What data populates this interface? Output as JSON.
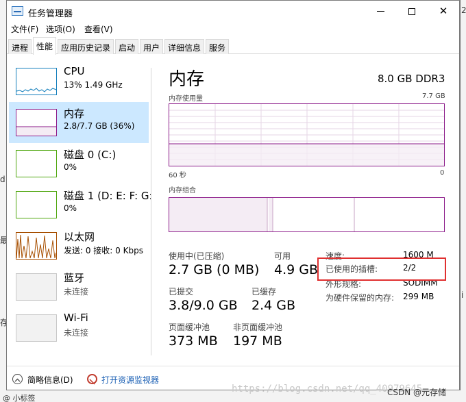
{
  "window": {
    "title": "任务管理器"
  },
  "background_text": {
    "right_top": "2",
    "left_mid": "d",
    "left_low": "最",
    "left_bottom": "存",
    "right_mid": "ⅰ",
    "bottom_strip": "@ 小标签"
  },
  "menu": [
    "文件(F)",
    "选项(O)",
    "查看(V)"
  ],
  "tabs": [
    {
      "label": "进程",
      "active": false
    },
    {
      "label": "性能",
      "active": true
    },
    {
      "label": "应用历史记录",
      "active": false
    },
    {
      "label": "启动",
      "active": false
    },
    {
      "label": "用户",
      "active": false
    },
    {
      "label": "详细信息",
      "active": false
    },
    {
      "label": "服务",
      "active": false
    }
  ],
  "sidebar": [
    {
      "name": "CPU",
      "sub": "13% 1.49 GHz",
      "thumb_color": "#117dbb",
      "selected": false
    },
    {
      "name": "内存",
      "sub": "2.8/7.7 GB (36%)",
      "thumb_color": "#8b1a89",
      "selected": true
    },
    {
      "name": "磁盘 0 (C:)",
      "sub": "0%",
      "thumb_color": "#4da60c",
      "selected": false
    },
    {
      "name": "磁盘 1 (D: E: F: G:",
      "sub": "0%",
      "thumb_color": "#4da60c",
      "selected": false
    },
    {
      "name": "以太网",
      "sub": "发送: 0 接收: 0 Kbps",
      "thumb_color": "#a74f01",
      "selected": false
    },
    {
      "name": "蓝牙",
      "sub": "未连接",
      "thumb_color": "#c8c8c8",
      "selected": false
    },
    {
      "name": "Wi-Fi",
      "sub": "未连接",
      "thumb_color": "#c8c8c8",
      "selected": false
    }
  ],
  "main": {
    "title": "内存",
    "spec": "8.0 GB DDR3",
    "usage_label": "内存使用量",
    "usage_max": "7.7 GB",
    "time_left": "60 秒",
    "time_right": "0",
    "composition_label": "内存组合",
    "usage_fraction": 0.36,
    "accent_color": "#8b1a89"
  },
  "stats": {
    "in_use_label": "使用中(已压缩)",
    "in_use_value": "2.7 GB (0 MB)",
    "available_label": "可用",
    "available_value": "4.9 GB",
    "committed_label": "已提交",
    "committed_value": "3.8/9.0 GB",
    "cached_label": "已缓存",
    "cached_value": "2.4 GB",
    "paged_label": "页面缓冲池",
    "paged_value": "373 MB",
    "nonpaged_label": "非页面缓冲池",
    "nonpaged_value": "197 MB"
  },
  "details": [
    {
      "label": "速度:",
      "value": "1600 M"
    },
    {
      "label": "已使用的插槽:",
      "value": "2/2"
    },
    {
      "label": "外形规格:",
      "value": "SODIMM"
    },
    {
      "label": "为硬件保留的内存:",
      "value": "299 MB"
    }
  ],
  "footer": {
    "summary": "简略信息(D)",
    "resource_monitor": "打开资源监视器"
  },
  "watermark": "https://blog.csdn.net/qq_40979645",
  "csdn": "CSDN @元存储"
}
